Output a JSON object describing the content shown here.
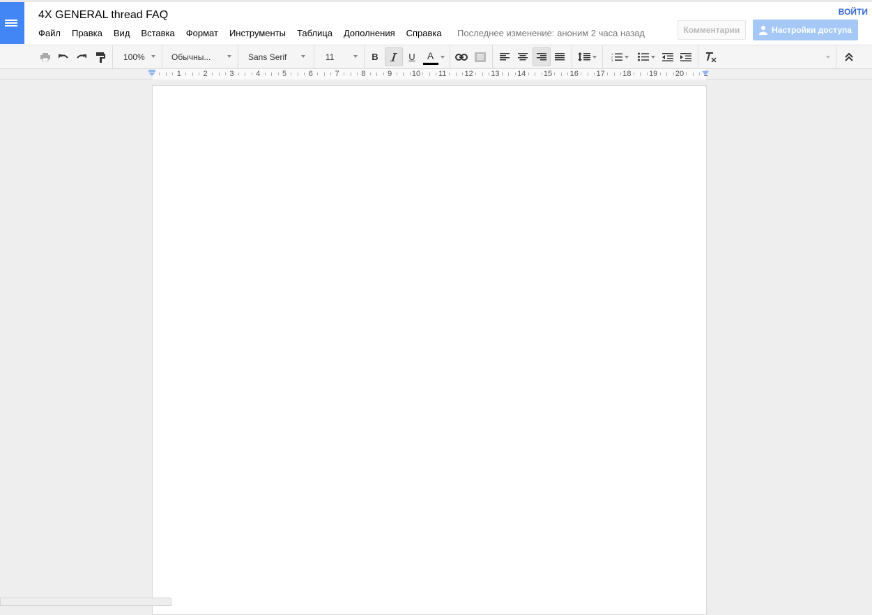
{
  "document": {
    "title": "4X GENERAL thread FAQ",
    "last_edit": "Последнее изменение: аноним 2 часа назад"
  },
  "menu": [
    "Файл",
    "Правка",
    "Вид",
    "Вставка",
    "Формат",
    "Инструменты",
    "Таблица",
    "Дополнения",
    "Справка"
  ],
  "account": {
    "login_label": "ВОЙТИ",
    "comments_label": "Комментарии",
    "share_label": "Настройки доступа"
  },
  "toolbar": {
    "zoom": "100%",
    "style": "Обычны...",
    "font": "Sans Serif",
    "font_size": "11",
    "bold_label": "B",
    "underline_label": "U",
    "text_color_label": "A",
    "text_color": "#000000",
    "active_alignment": "right",
    "italic_active": true,
    "icons": [
      "print-icon",
      "undo-icon",
      "redo-icon",
      "paint-format-icon",
      "link-icon",
      "comment-icon",
      "align-left-icon",
      "align-center-icon",
      "align-right-icon",
      "align-justify-icon",
      "line-spacing-icon",
      "numbered-list-icon",
      "bulleted-list-icon",
      "decrease-indent-icon",
      "increase-indent-icon",
      "clear-formatting-icon",
      "collapse-toolbar-icon"
    ]
  },
  "ruler": {
    "labels": [
      "1",
      "2",
      "3",
      "4",
      "5",
      "6",
      "7",
      "8",
      "9",
      "10",
      "11",
      "12",
      "13",
      "14",
      "15",
      "16",
      "17",
      "18",
      "19",
      "20",
      "2"
    ]
  },
  "colors": {
    "brand": "#4285f4",
    "share_button": "#a5c8f6",
    "login_link": "#3366cc"
  }
}
